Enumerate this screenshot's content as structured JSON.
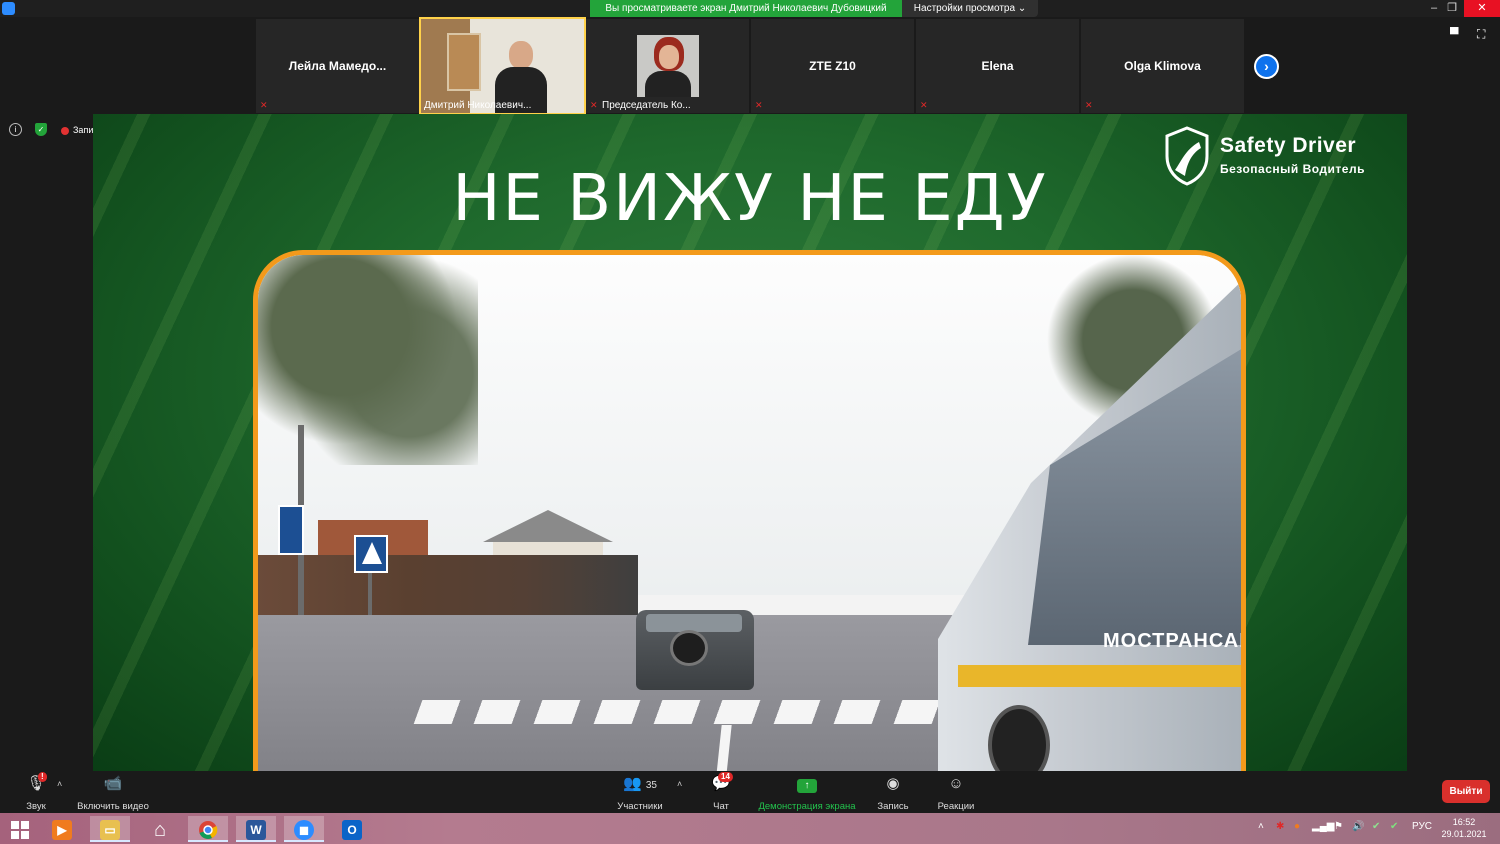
{
  "window": {
    "share_banner": "Вы просматриваете экран Дмитрий Николаевич Дубовицкий",
    "view_options": "Настройки просмотра ⌄",
    "minimize": "–",
    "restore": "❐",
    "close": "✕"
  },
  "participants": [
    {
      "name": "Лейла  Мамедо...",
      "muted": true,
      "video": false
    },
    {
      "name": "Дмитрий Николаевич...",
      "muted": false,
      "video": true,
      "active": true
    },
    {
      "name": "Председатель Ко...",
      "muted": true,
      "video": true
    },
    {
      "name": "ZTE Z10",
      "muted": true,
      "video": false
    },
    {
      "name": "Elena",
      "muted": true,
      "video": false
    },
    {
      "name": "Olga Klimova",
      "muted": true,
      "video": false
    }
  ],
  "indicators": {
    "info": "i",
    "security": "✓",
    "recording": "Запись"
  },
  "slide": {
    "title": "НЕ ВИЖУ НЕ ЕДУ",
    "logo_brand": "Safety Driver",
    "logo_sub": "Безопасный Водитель",
    "bus_text": "МОСТРАНСАВТО"
  },
  "toolbar": {
    "audio": "Звук",
    "video": "Включить видео",
    "participants": "Участники",
    "participants_count": "35",
    "chat": "Чат",
    "chat_badge": "14",
    "share": "Демонстрация экрана",
    "record": "Запись",
    "reactions": "Реакции",
    "leave": "Выйти",
    "audio_badge": "!"
  },
  "taskbar": {
    "lang": "РУС",
    "time": "16:52",
    "date": "29.01.2021"
  },
  "colors": {
    "zoom_blue": "#0e72ed",
    "share_green": "#23a43a",
    "leave_red": "#d9302c",
    "slide_border": "#f39a1b"
  }
}
